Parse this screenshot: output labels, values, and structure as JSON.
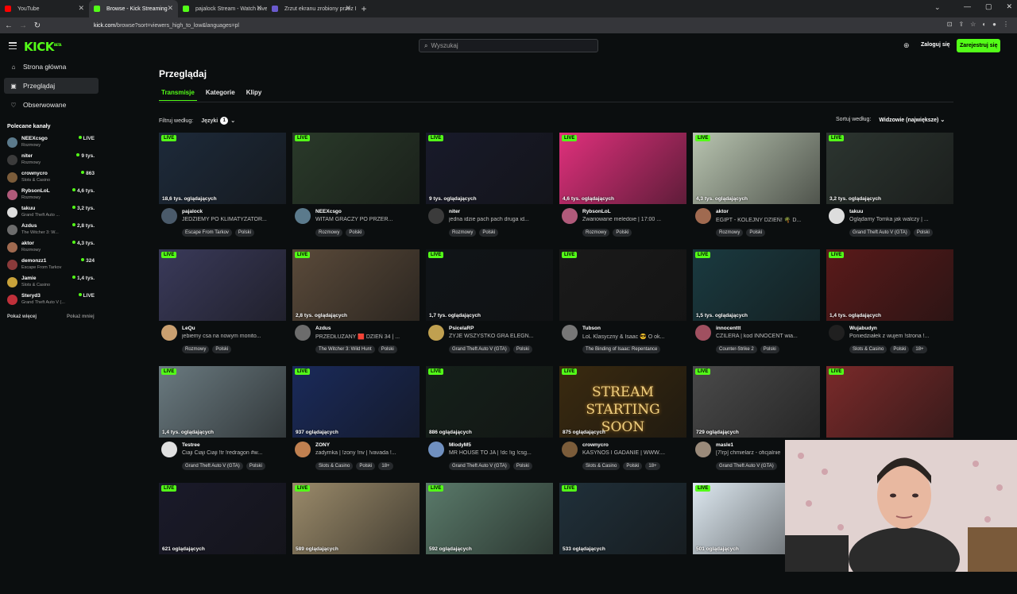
{
  "browser": {
    "tabs": [
      {
        "title": "YouTube",
        "fav_color": "#ff0000",
        "active": false
      },
      {
        "title": "Browse - Kick Streaming",
        "fav_color": "#53fc18",
        "active": true
      },
      {
        "title": "pajalock Stream - Watch Live o",
        "fav_color": "#53fc18",
        "active": false
      },
      {
        "title": "Zrzut ekranu zrobiony przez Lig",
        "fav_color": "#6a5acd",
        "active": false
      }
    ],
    "url_host": "kick.com",
    "url_path": "/browse?sort=viewers_high_to_low&languages=pl"
  },
  "header": {
    "logo": "KICK",
    "logo_sup": "BETA",
    "search_placeholder": "Wyszukaj",
    "login": "Zaloguj się",
    "register": "Zarejestruj się"
  },
  "sidebar": {
    "nav": [
      {
        "label": "Strona główna",
        "icon": "home-icon",
        "glyph": "⌂"
      },
      {
        "label": "Przeglądaj",
        "icon": "browse-icon",
        "glyph": "▣"
      },
      {
        "label": "Obserwowane",
        "icon": "heart-icon",
        "glyph": "♡"
      }
    ],
    "recommended_title": "Polecane kanały",
    "channels": [
      {
        "name": "NEEXcsgo",
        "category": "Rozmowy",
        "viewers": "LIVE",
        "color": "#5b7a8c"
      },
      {
        "name": "niter",
        "category": "Rozmowy",
        "viewers": "9 tys.",
        "color": "#3b3b3b"
      },
      {
        "name": "crownycro",
        "category": "Slots & Casino",
        "viewers": "863",
        "color": "#7b5c3a"
      },
      {
        "name": "RybsonLoL",
        "category": "Rozmowy",
        "viewers": "4,6 tys.",
        "color": "#b05a7a"
      },
      {
        "name": "takuu",
        "category": "Grand Theft Auto ...",
        "viewers": "3,2 tys.",
        "color": "#dddddd"
      },
      {
        "name": "Azdus",
        "category": "The Witcher 3: W...",
        "viewers": "2,8 tys.",
        "color": "#6c6c6c"
      },
      {
        "name": "aktor",
        "category": "Rozmowy",
        "viewers": "4,3 tys.",
        "color": "#a06a50"
      },
      {
        "name": "demonzz1",
        "category": "Escape From Tarkov",
        "viewers": "324",
        "color": "#8a3a3a"
      },
      {
        "name": "Jamie",
        "category": "Slots & Casino",
        "viewers": "1,4 tys.",
        "color": "#c9a23a"
      },
      {
        "name": "Steryd3",
        "category": "Grand Theft Auto V (...",
        "viewers": "LIVE",
        "color": "#c0303a"
      }
    ],
    "show_more": "Pokaż więcej",
    "show_less": "Pokaż mniej"
  },
  "main": {
    "title": "Przeglądaj",
    "tabs": [
      "Transmisje",
      "Kategorie",
      "Klipy"
    ],
    "filter_label": "Filtruj według:",
    "filter_lang": "Języki",
    "filter_count": "1",
    "sort_label": "Sortuj według:",
    "sort_value": "Widzowie (największe)",
    "live_label": "LIVE"
  },
  "streams": [
    {
      "viewers": "18,6 tys. oglądających",
      "name": "pajalock",
      "title": "JEDZIEMY PO KLIMATYZATOR...",
      "tags": [
        "Escape From Tarkov",
        "Polski"
      ],
      "bg": "#1d2a3a",
      "av": "#4a5a6a"
    },
    {
      "viewers": "",
      "name": "NEEXcsgo",
      "title": "WITAM GRACZY PO PRZER...",
      "tags": [
        "Rozmowy",
        "Polski"
      ],
      "bg": "#2a3a2a",
      "av": "#5b7a8c"
    },
    {
      "viewers": "9 tys. oglądających",
      "name": "niter",
      "title": "jedna idzie pach pach druga id...",
      "tags": [
        "Rozmowy",
        "Polski"
      ],
      "bg": "#181a2a",
      "av": "#3b3b3b"
    },
    {
      "viewers": "4,6 tys. oglądających",
      "name": "RybsonLoL",
      "title": "Zwariowane meledoie | 17:00 ...",
      "tags": [
        "Rozmowy",
        "Polski"
      ],
      "bg": "#e0307c",
      "av": "#b05a7a"
    },
    {
      "viewers": "4,3 tys. oglądających",
      "name": "aktor",
      "title": "EGIPT - KOLEJNY DZIEŃ! 🌴 D...",
      "tags": [
        "Rozmowy",
        "Polski"
      ],
      "bg": "#b8c4b0",
      "av": "#a06a50"
    },
    {
      "viewers": "3,2 tys. oglądających",
      "name": "takuu",
      "title": "Oglądamy Tomka jak walczy | ...",
      "tags": [
        "Grand Theft Auto V (GTA)",
        "Polski"
      ],
      "bg": "#2c3530",
      "av": "#dddddd"
    },
    {
      "viewers": "",
      "name": "LeQu",
      "title": "jebiemy csa na nowym monito...",
      "tags": [
        "Rozmowy",
        "Polski"
      ],
      "bg": "#3a3a5a",
      "av": "#caa070"
    },
    {
      "viewers": "2,8 tys. oglądających",
      "name": "Azdus",
      "title": "PRZEDŁUŻANY 🟥 DZIEŃ 34 | ...",
      "tags": [
        "The Witcher 3: Wild Hunt",
        "Polski"
      ],
      "bg": "#5a4a3a",
      "av": "#6c6c6c"
    },
    {
      "viewers": "1,7 tys. oglądających",
      "name": "PsicelaRP",
      "title": "ZYJE WSZYSTKO GRA ELEGN...",
      "tags": [
        "Grand Theft Auto V (GTA)",
        "Polski"
      ],
      "bg": "#101418",
      "av": "#c0a050"
    },
    {
      "viewers": "",
      "name": "Tubson",
      "title": "LoL Klasyczny & Isaac 😎 O ok...",
      "tags": [
        "The Binding of Isaac: Repentance"
      ],
      "bg": "#1a1a1a",
      "av": "#777777"
    },
    {
      "viewers": "1,5 tys. oglądających",
      "name": "innocenttt",
      "title": "CZILERA | kod INNOCENT wia...",
      "tags": [
        "Counter-Strike 2",
        "Polski"
      ],
      "bg": "#1a3a40",
      "av": "#a05060"
    },
    {
      "viewers": "1,4 tys. oglądających",
      "name": "Wujabudyn",
      "title": "Poniedziałek z wujem !strona !...",
      "tags": [
        "Slots & Casino",
        "Polski",
        "18+"
      ],
      "bg": "#5a1a1a",
      "av": "#202020"
    },
    {
      "viewers": "1,4 tys. oglądających",
      "name": "Testree",
      "title": "Ciaji Ciaji Ciaji !tr !redragon #w...",
      "tags": [
        "Grand Theft Auto V (GTA)",
        "Polski"
      ],
      "bg": "#6a7a80",
      "av": "#e0e0e0"
    },
    {
      "viewers": "937 oglądających",
      "name": "ZONY",
      "title": "zadymka | !zony !nv | !vavada !...",
      "tags": [
        "Slots & Casino",
        "Polski",
        "18+"
      ],
      "bg": "#1a2a5a",
      "av": "#c08050"
    },
    {
      "viewers": "886 oglądających",
      "name": "MlodyM5",
      "title": "MR HOUSE TO JA | !dc !ig !csg...",
      "tags": [
        "Grand Theft Auto V (GTA)",
        "Polski"
      ],
      "bg": "#15201a",
      "av": "#7090c0"
    },
    {
      "viewers": "875 oglądających",
      "name": "crownycro",
      "title": "KASYNOS I GADANIE | WWW....",
      "tags": [
        "Slots & Casino",
        "Polski",
        "18+"
      ],
      "bg": "#3a2a10",
      "av": "#7b5c3a",
      "text_overlay": "STREAM STARTING SOON"
    },
    {
      "viewers": "729 oglądających",
      "name": "masle1",
      "title": "[7!rp] chmielarz - oficjalnie",
      "tags": [
        "Grand Theft Auto V (GTA)"
      ],
      "bg": "#4a4a4a",
      "av": "#9a8a7a"
    },
    {
      "viewers": "",
      "name": "",
      "title": "",
      "tags": [],
      "bg": "#7a2a2a",
      "av": "#7a2a2a"
    },
    {
      "viewers": "621 oglądających",
      "name": "",
      "title": "",
      "tags": [],
      "bg": "#1a1a2a",
      "av": ""
    },
    {
      "viewers": "589 oglądających",
      "name": "",
      "title": "",
      "tags": [],
      "bg": "#9a8a6a",
      "av": ""
    },
    {
      "viewers": "592 oglądających",
      "name": "",
      "title": "",
      "tags": [],
      "bg": "#5a7a6a",
      "av": ""
    },
    {
      "viewers": "533 oglądających",
      "name": "",
      "title": "",
      "tags": [],
      "bg": "#20303a",
      "av": ""
    },
    {
      "viewers": "501 oglądających",
      "name": "",
      "title": "",
      "tags": [],
      "bg": "#dde8f0",
      "av": ""
    },
    {
      "viewers": "",
      "name": "",
      "title": "",
      "tags": [],
      "bg": "#101010",
      "av": ""
    }
  ]
}
